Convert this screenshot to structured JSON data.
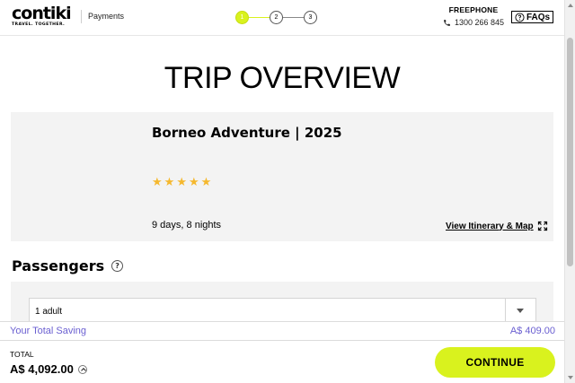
{
  "header": {
    "logo_word": "contiki",
    "logo_tagline": "TRAVEL. TOGETHER.",
    "breadcrumb": "Payments",
    "steps": [
      {
        "label": "1",
        "state": "active"
      },
      {
        "label": "2",
        "state": "pending"
      },
      {
        "label": "3",
        "state": "pending"
      }
    ],
    "freephone_label": "FREEPHONE",
    "freephone_number": "1300 266 845",
    "faq_label": "FAQs"
  },
  "page_title": "TRIP OVERVIEW",
  "trip": {
    "title": "Borneo Adventure | 2025",
    "rating": 5,
    "stars": [
      "★",
      "★",
      "★",
      "★",
      "★"
    ],
    "duration": "9 days, 8 nights",
    "itinerary_link": "View Itinerary & Map"
  },
  "passengers": {
    "heading": "Passengers",
    "help_icon": "?",
    "selected": "1 adult"
  },
  "saving": {
    "label": "Your Total Saving",
    "value": "A$ 409.00"
  },
  "footer": {
    "total_label": "TOTAL",
    "total_value": "A$ 4,092.00",
    "continue_label": "CONTINUE"
  },
  "colors": {
    "accent": "#d9f21e",
    "saving_text": "#6a5fd1",
    "star": "#f5b82e",
    "card_bg": "#f3f3f3"
  }
}
